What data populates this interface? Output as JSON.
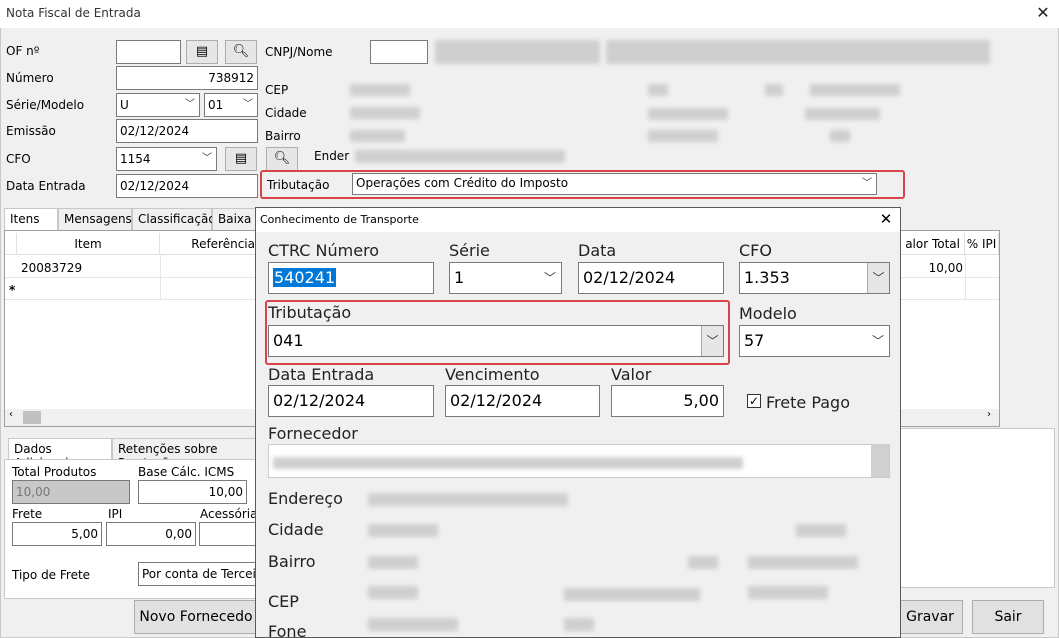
{
  "window": {
    "title": "Nota Fiscal de Entrada",
    "close": "✕"
  },
  "form": {
    "of_label": "OF nº",
    "of_value": "",
    "numero_label": "Número",
    "numero_value": "738912",
    "serie_label": "Série/Modelo",
    "serie_value": "U",
    "modelo_value": "01",
    "emissao_label": "Emissão",
    "emissao_value": "02/12/2024",
    "cfo_label": "CFO",
    "cfo_value": "1154",
    "data_entrada_label": "Data Entrada",
    "data_entrada_value": "02/12/2024",
    "cnpj_label": "CNPJ/Nome",
    "cnpj_value": "",
    "cep_label": "CEP",
    "cidade_label": "Cidade",
    "bairro_label": "Bairro",
    "endereco_label": "Ender",
    "tributacao_label": "Tributação",
    "tributacao_value": "Operações com Crédito do Imposto"
  },
  "tabs": [
    "Itens",
    "Mensagens",
    "Classificação",
    "Baixa n"
  ],
  "grid": {
    "columns": [
      "Item",
      "Referência",
      "alor Total",
      "% IPI"
    ],
    "rows": [
      {
        "item": "20083729",
        "total": "10,00"
      }
    ],
    "new_row_marker": "*"
  },
  "bottom_tabs": [
    "Dados Adicionais",
    "Retenções sobre Prestaçã"
  ],
  "totals": {
    "total_produtos_label": "Total Produtos",
    "total_produtos_value": "10,00",
    "base_icms_label": "Base Cálc. ICMS",
    "base_icms_value": "10,00",
    "frete_label": "Frete",
    "frete_value": "5,00",
    "ipi_label": "IPI",
    "ipi_value": "0,00",
    "acessorias_label": "Acessórias",
    "tipo_frete_label": "Tipo de Frete",
    "tipo_frete_value": "Por conta de Terceiro"
  },
  "buttons": {
    "novo_fornecedor": "Novo Fornecedo",
    "gravar": "Gravar",
    "sair": "Sair"
  },
  "dialog": {
    "title": "Conhecimento de Transporte",
    "close": "✕",
    "ctrc_label": "CTRC Número",
    "ctrc_value": "540241",
    "serie_label": "Série",
    "serie_value": "1",
    "data_label": "Data",
    "data_value": "02/12/2024",
    "cfo_label": "CFO",
    "cfo_value": "1.353",
    "tributacao_label": "Tributação",
    "tributacao_value": "041",
    "modelo_label": "Modelo",
    "modelo_value": "57",
    "data_entrada_label": "Data Entrada",
    "data_entrada_value": "02/12/2024",
    "vencimento_label": "Vencimento",
    "vencimento_value": "02/12/2024",
    "valor_label": "Valor",
    "valor_value": "5,00",
    "frete_pago_label": "Frete Pago",
    "frete_pago_checked": true,
    "fornecedor_label": "Fornecedor",
    "endereco_label": "Endereço",
    "cidade_label": "Cidade",
    "bairro_label": "Bairro",
    "cep_label": "CEP",
    "fone_label": "Fone"
  },
  "icons": {
    "list": "list-icon",
    "search": "search-icon",
    "check": "✓"
  },
  "colors": {
    "highlight_border": "#d9434a",
    "selection": "#0078d7"
  }
}
